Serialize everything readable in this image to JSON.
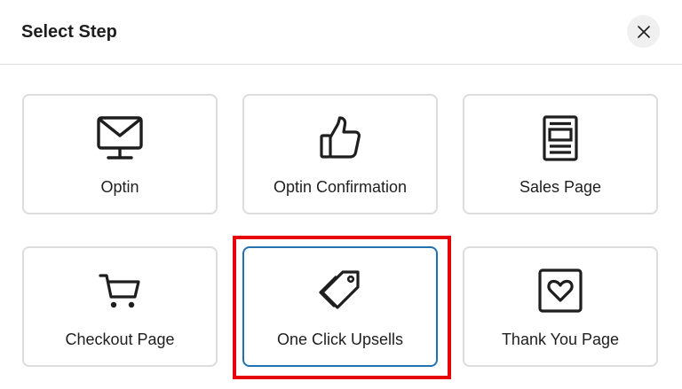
{
  "header": {
    "title": "Select Step",
    "close_icon": "close-icon"
  },
  "steps": [
    {
      "label": "Optin",
      "icon": "envelope-monitor-icon"
    },
    {
      "label": "Optin Confirmation",
      "icon": "thumbs-up-icon"
    },
    {
      "label": "Sales Page",
      "icon": "page-layout-icon"
    },
    {
      "label": "Checkout Page",
      "icon": "shopping-cart-icon"
    },
    {
      "label": "One Click Upsells",
      "icon": "price-tags-icon",
      "selected": true
    },
    {
      "label": "Thank You Page",
      "icon": "heart-frame-icon"
    }
  ],
  "colors": {
    "selected_border": "#2271b1",
    "highlight_box": "#e5040b",
    "card_border": "#dcdcde"
  }
}
